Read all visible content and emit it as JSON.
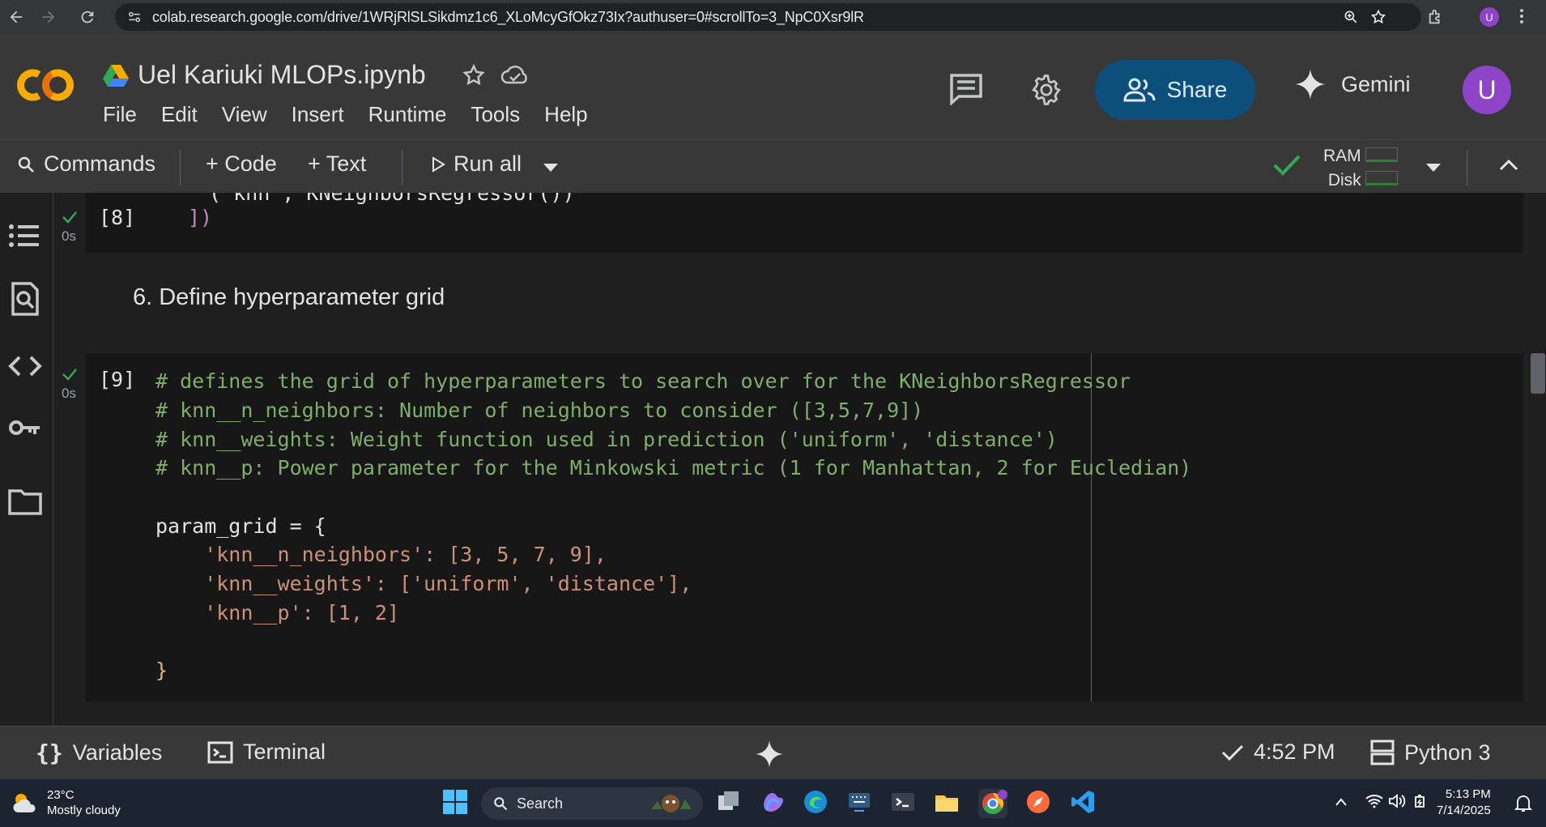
{
  "browser": {
    "url": "colab.research.google.com/drive/1WRjRlSLSikdmz1c6_XLoMcyGfOkz73Ix?authuser=0#scrollTo=3_NpC0Xsr9lR",
    "profile_initial": "U"
  },
  "header": {
    "notebook_title": "Uel Kariuki MLOPs.ipynb",
    "menu": [
      "File",
      "Edit",
      "View",
      "Insert",
      "Runtime",
      "Tools",
      "Help"
    ],
    "share_label": "Share",
    "gemini_label": "Gemini",
    "avatar_initial": "U"
  },
  "toolbar": {
    "commands_label": "Commands",
    "code_label": "+ Code",
    "text_label": "+ Text",
    "run_all_label": "Run all",
    "ram_label": "RAM",
    "disk_label": "Disk"
  },
  "cells": {
    "cell8": {
      "count": "[8]",
      "time": "0s",
      "partial_line": "('knn', KNeighborsRegressor())",
      "last_line": "])"
    },
    "markdown": {
      "heading": "6. Define hyperparameter grid"
    },
    "cell9": {
      "count": "[9]",
      "time": "0s",
      "lines": [
        "# defines the grid of hyperparameters to search over for the KNeighborsRegressor",
        "# knn__n_neighbors: Number of neighbors to consider ([3,5,7,9])",
        "# knn__weights: Weight function used in prediction ('uniform', 'distance')",
        "# knn__p: Power parameter for the Minkowski metric (1 for Manhattan, 2 for Eucledian)",
        "",
        "param_grid = {",
        "    'knn__n_neighbors': [3, 5, 7, 9],",
        "    'knn__weights': ['uniform', 'distance'],",
        "    'knn__p': [1, 2]",
        "",
        "}"
      ]
    }
  },
  "status_bar": {
    "variables_label": "Variables",
    "terminal_label": "Terminal",
    "exec_time": "4:52 PM",
    "kernel_label": "Python 3"
  },
  "taskbar": {
    "temperature": "23°C",
    "weather": "Mostly cloudy",
    "search_label": "Search",
    "time": "5:13 PM",
    "date": "7/14/2025"
  },
  "colors": {
    "accent_blue": "#0b4f7a",
    "success_green": "#34a853",
    "avatar_purple": "#8e44c9",
    "colab_orange": "#f9ab00"
  }
}
